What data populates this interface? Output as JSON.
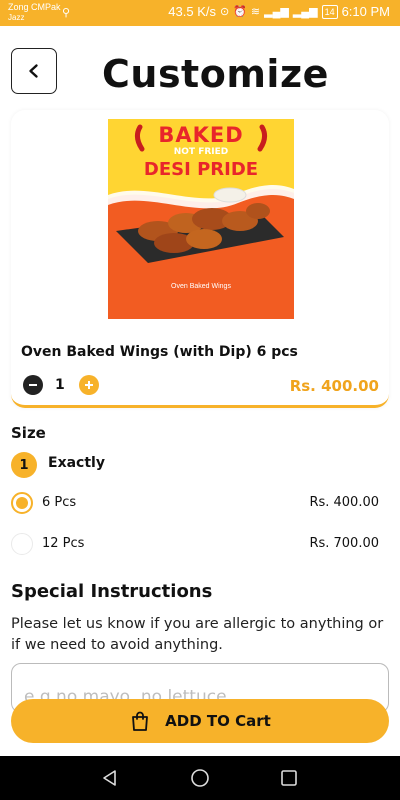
{
  "status_bar": {
    "carrier_primary": "Zong CMPak",
    "carrier_secondary": "Jazz",
    "network_speed": "43.5 K/s",
    "battery": "14",
    "time": "6:10 PM"
  },
  "header": {
    "title": "Customize"
  },
  "product": {
    "image_headline_1": "BAKED",
    "image_headline_2": "NOT FRIED",
    "image_headline_3": "DESI PRIDE",
    "image_caption": "Oven Baked Wings",
    "name": "Oven Baked Wings (with Dip) 6 pcs",
    "quantity": "1",
    "price": "Rs. 400.00"
  },
  "size": {
    "label": "Size",
    "rule_count": "1",
    "rule_text": "Exactly",
    "options": [
      {
        "label": "6 Pcs",
        "price": "Rs. 400.00",
        "selected": true
      },
      {
        "label": "12 Pcs",
        "price": "Rs. 700.00",
        "selected": false
      }
    ]
  },
  "special_instructions": {
    "title": "Special Instructions",
    "description": "Please let us know if you are allergic to anything or if we need to avoid anything.",
    "placeholder": "e.g no mayo, no lettuce"
  },
  "cart": {
    "button_label": "ADD TO Cart"
  },
  "colors": {
    "accent": "#f7b22a",
    "price": "#f0a41d",
    "image_background": "#ffd532",
    "image_wave": "#f25c22"
  },
  "icons": [
    "back-chevron-icon",
    "minus-icon",
    "plus-icon",
    "shopping-bag-icon",
    "nav-back-icon",
    "nav-home-icon",
    "nav-recents-icon"
  ]
}
